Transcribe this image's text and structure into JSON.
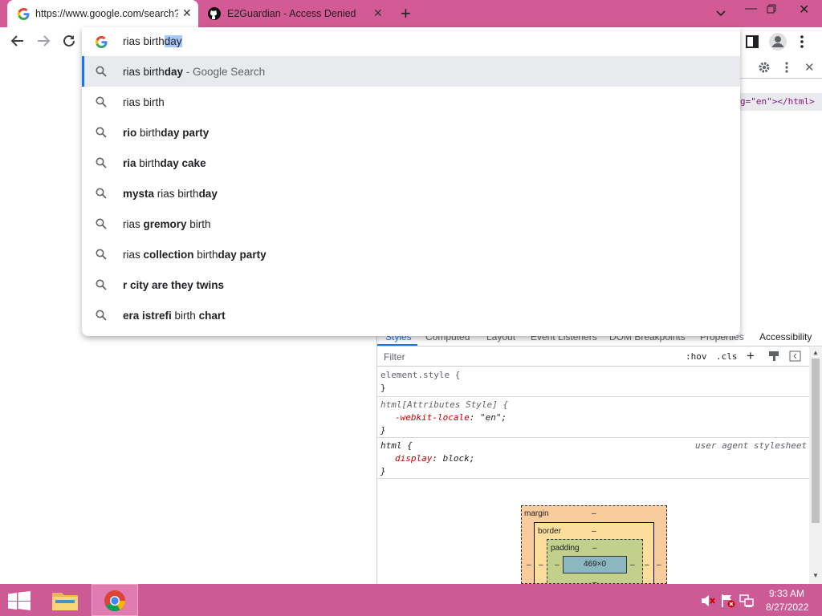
{
  "tabs": [
    {
      "title": "https://www.google.com/search?q",
      "favicon": "google-g-icon",
      "active": true
    },
    {
      "title": "E2Guardian - Access Denied",
      "favicon": "github-icon",
      "active": false
    }
  ],
  "omnibox": {
    "typed": "rias birth",
    "autocomplete": "day"
  },
  "suggestions": [
    {
      "parts": [
        {
          "t": "rias birth",
          "b": false
        },
        {
          "t": "day",
          "b": true
        }
      ],
      "suffix": " - Google Search",
      "selected": true
    },
    {
      "parts": [
        {
          "t": "rias birth",
          "b": false
        }
      ],
      "suffix": "",
      "selected": false
    },
    {
      "parts": [
        {
          "t": "rio",
          "b": true
        },
        {
          "t": " birth",
          "b": false
        },
        {
          "t": "day party",
          "b": true
        }
      ],
      "suffix": "",
      "selected": false
    },
    {
      "parts": [
        {
          "t": "ria",
          "b": true
        },
        {
          "t": " birth",
          "b": false
        },
        {
          "t": "day cake",
          "b": true
        }
      ],
      "suffix": "",
      "selected": false
    },
    {
      "parts": [
        {
          "t": "mysta",
          "b": true
        },
        {
          "t": " rias birth",
          "b": false
        },
        {
          "t": "day",
          "b": true
        }
      ],
      "suffix": "",
      "selected": false
    },
    {
      "parts": [
        {
          "t": "rias ",
          "b": false
        },
        {
          "t": "gremory",
          "b": true
        },
        {
          "t": " birth",
          "b": false
        }
      ],
      "suffix": "",
      "selected": false
    },
    {
      "parts": [
        {
          "t": "rias ",
          "b": false
        },
        {
          "t": "collection",
          "b": true
        },
        {
          "t": " birth",
          "b": false
        },
        {
          "t": "day party",
          "b": true
        }
      ],
      "suffix": "",
      "selected": false
    },
    {
      "parts": [
        {
          "t": "r city are they twins",
          "b": true
        }
      ],
      "suffix": "",
      "selected": false
    },
    {
      "parts": [
        {
          "t": "era istrefi",
          "b": true
        },
        {
          "t": " birth ",
          "b": false
        },
        {
          "t": "chart",
          "b": true
        }
      ],
      "suffix": "",
      "selected": false
    }
  ],
  "devtools": {
    "elements_line": "g=\"en\"></html>",
    "panel_tabs": [
      "Styles",
      "Computed",
      "Layout",
      "Event Listeners",
      "DOM Breakpoints",
      "Properties",
      "Accessibility"
    ],
    "filter_placeholder": "Filter",
    "hov": ":hov",
    "cls": ".cls",
    "rules": {
      "element_style": "element.style {",
      "close1": "}",
      "attr_selector": "html[Attributes Style] {",
      "attr_prop": "-webkit-locale",
      "attr_val": "\"en\"",
      "close2": "}",
      "html_selector": "html {",
      "ua_label": "user agent stylesheet",
      "display_prop": "display",
      "display_val": "block",
      "close3": "}"
    },
    "boxmodel": {
      "margin_label": "margin",
      "border_label": "border",
      "padding_label": "padding",
      "dash": "–",
      "content": "469×0"
    }
  },
  "taskbar": {
    "time": "9:33 AM",
    "date": "8/27/2022"
  },
  "colors": {
    "titlebar": "#d35a94",
    "taskbar": "#cc5a95",
    "selection": "#a8c7fa",
    "accent": "#1a73e8"
  }
}
